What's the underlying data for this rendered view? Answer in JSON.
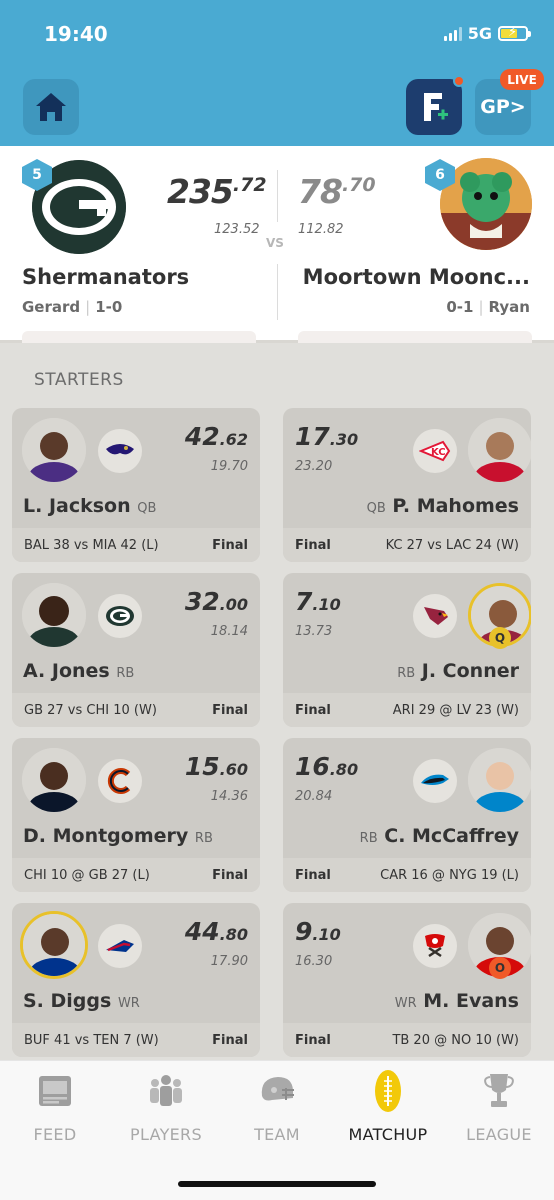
{
  "status_bar": {
    "time": "19:40",
    "network": "5G"
  },
  "header": {
    "gp_label": "GP>",
    "live_label": "LIVE"
  },
  "matchup": {
    "left": {
      "rank": "5",
      "score_int": "235",
      "score_dec": ".72",
      "projected": "123.52",
      "name": "Shermanators",
      "owner": "Gerard",
      "record": "1-0"
    },
    "vs": "VS",
    "right": {
      "rank": "6",
      "score_int": "78",
      "score_dec": ".70",
      "projected": "112.82",
      "name": "Moortown Moonc...",
      "owner": "Ryan",
      "record": "0-1"
    }
  },
  "section_title": "STARTERS",
  "cards": [
    {
      "name": "L. Jackson",
      "pos": "QB",
      "pts_int": "42",
      "pts_dec": ".62",
      "proj": "19.70",
      "game": "BAL 38 vs MIA 42 (L)",
      "status": "Final",
      "badge": ""
    },
    {
      "name": "P. Mahomes",
      "pos": "QB",
      "pts_int": "17",
      "pts_dec": ".30",
      "proj": "23.20",
      "game": "KC 27 vs LAC 24 (W)",
      "status": "Final",
      "badge": ""
    },
    {
      "name": "A. Jones",
      "pos": "RB",
      "pts_int": "32",
      "pts_dec": ".00",
      "proj": "18.14",
      "game": "GB 27 vs CHI 10 (W)",
      "status": "Final",
      "badge": ""
    },
    {
      "name": "J. Conner",
      "pos": "RB",
      "pts_int": "7",
      "pts_dec": ".10",
      "proj": "13.73",
      "game": "ARI 29 @ LV 23 (W)",
      "status": "Final",
      "badge": "Q"
    },
    {
      "name": "D. Montgomery",
      "pos": "RB",
      "pts_int": "15",
      "pts_dec": ".60",
      "proj": "14.36",
      "game": "CHI 10 @ GB 27 (L)",
      "status": "Final",
      "badge": ""
    },
    {
      "name": "C. McCaffrey",
      "pos": "RB",
      "pts_int": "16",
      "pts_dec": ".80",
      "proj": "20.84",
      "game": "CAR 16 @ NYG 19 (L)",
      "status": "Final",
      "badge": ""
    },
    {
      "name": "S. Diggs",
      "pos": "WR",
      "pts_int": "44",
      "pts_dec": ".80",
      "proj": "17.90",
      "game": "BUF 41 vs TEN 7 (W)",
      "status": "Final",
      "badge": ""
    },
    {
      "name": "M. Evans",
      "pos": "WR",
      "pts_int": "9",
      "pts_dec": ".10",
      "proj": "16.30",
      "game": "TB 20 @ NO 10 (W)",
      "status": "Final",
      "badge": "O"
    }
  ],
  "tabs": [
    {
      "label": "FEED",
      "icon": "feed-icon"
    },
    {
      "label": "PLAYERS",
      "icon": "players-icon"
    },
    {
      "label": "TEAM",
      "icon": "helmet-icon"
    },
    {
      "label": "MATCHUP",
      "icon": "football-icon",
      "active": true
    },
    {
      "label": "LEAGUE",
      "icon": "trophy-icon"
    }
  ]
}
